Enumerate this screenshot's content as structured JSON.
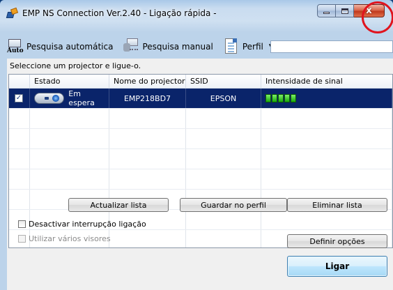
{
  "window": {
    "title": "EMP NS Connection Ver.2.40 - Ligação rápida -",
    "controls": {
      "close_label": "x"
    }
  },
  "toolbar": {
    "auto_search_label": "Pesquisa automática",
    "auto_icon_text": "Auto",
    "manual_search_label": "Pesquisa manual",
    "profile_label": "Perfil",
    "profile_field_value": ""
  },
  "main": {
    "instruction": "Seleccione um projector e ligue-o.",
    "columns": [
      "Estado",
      "Nome do projector",
      "SSID",
      "Intensidade de sinal"
    ],
    "rows": [
      {
        "checked": true,
        "status": "Em espera",
        "projector_name": "EMP218BD7",
        "ssid": "EPSON",
        "signal_bars": 5
      }
    ],
    "buttons": {
      "refresh_list": "Actualizar lista",
      "save_profile": "Guardar no perfil",
      "clear_list": "Eliminar lista",
      "set_options": "Definir opções",
      "connect": "Ligar"
    },
    "options": {
      "disable_interrupt": "Desactivar interrupção ligação",
      "multi_display": "Utilizar vários visores"
    }
  },
  "colors": {
    "selected_row": "#0a246a",
    "close_highlight": "#e0141e",
    "signal_green": "#18a80a"
  },
  "icons": [
    "app-icon",
    "auto-search-icon",
    "manual-search-icon",
    "profile-icon",
    "projector-icon",
    "signal-icon"
  ]
}
